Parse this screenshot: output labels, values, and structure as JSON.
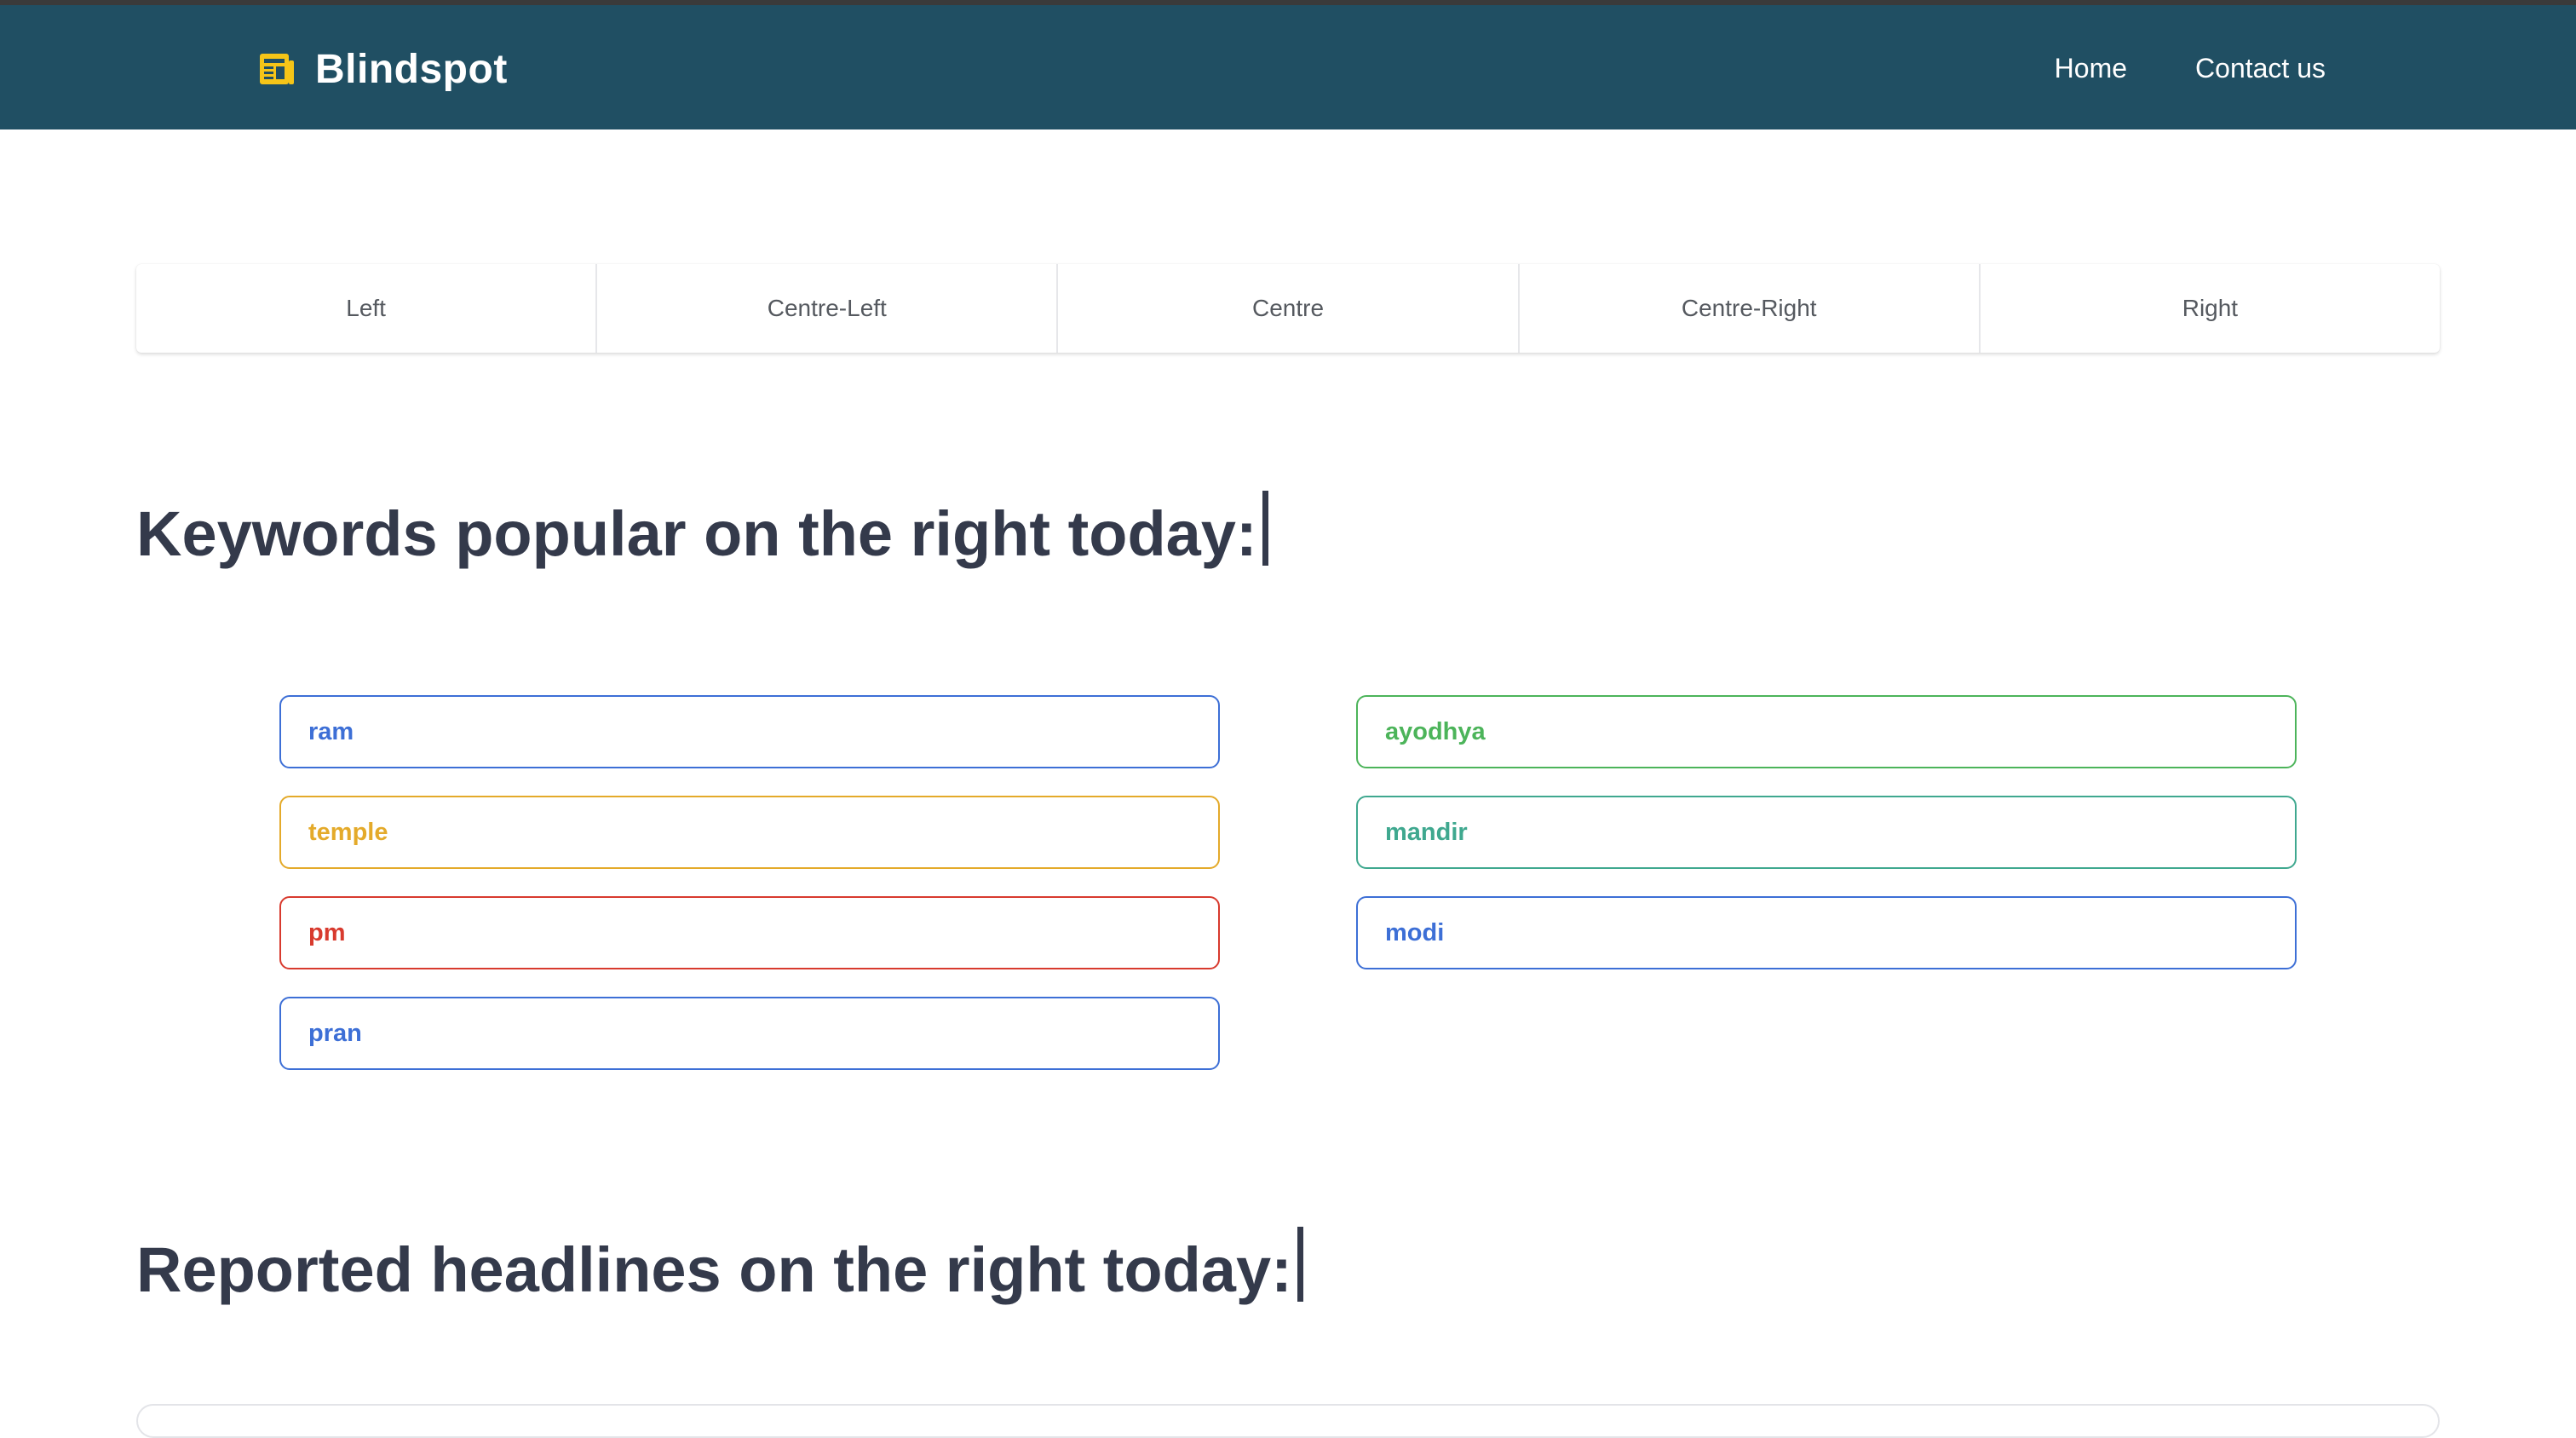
{
  "header": {
    "brand": "Blindspot",
    "nav": [
      {
        "label": "Home"
      },
      {
        "label": "Contact us"
      }
    ]
  },
  "tabs": [
    {
      "label": "Left"
    },
    {
      "label": "Centre-Left"
    },
    {
      "label": "Centre"
    },
    {
      "label": "Centre-Right"
    },
    {
      "label": "Right"
    }
  ],
  "keywords_section": {
    "title": "Keywords popular on the right today:"
  },
  "keywords": [
    {
      "label": "ram",
      "color": "#3d6fd6"
    },
    {
      "label": "ayodhya",
      "color": "#4cb45a"
    },
    {
      "label": "temple",
      "color": "#e4aa2a"
    },
    {
      "label": "mandir",
      "color": "#3fa88f"
    },
    {
      "label": "pm",
      "color": "#d83a2e"
    },
    {
      "label": "modi",
      "color": "#3d6fd6"
    },
    {
      "label": "pran",
      "color": "#3d6fd6"
    }
  ],
  "headlines_section": {
    "title": "Reported headlines on the right today:"
  },
  "colors": {
    "navbar": "#204f63",
    "heading": "#343a4b",
    "brand_icon": "#f5c518"
  }
}
